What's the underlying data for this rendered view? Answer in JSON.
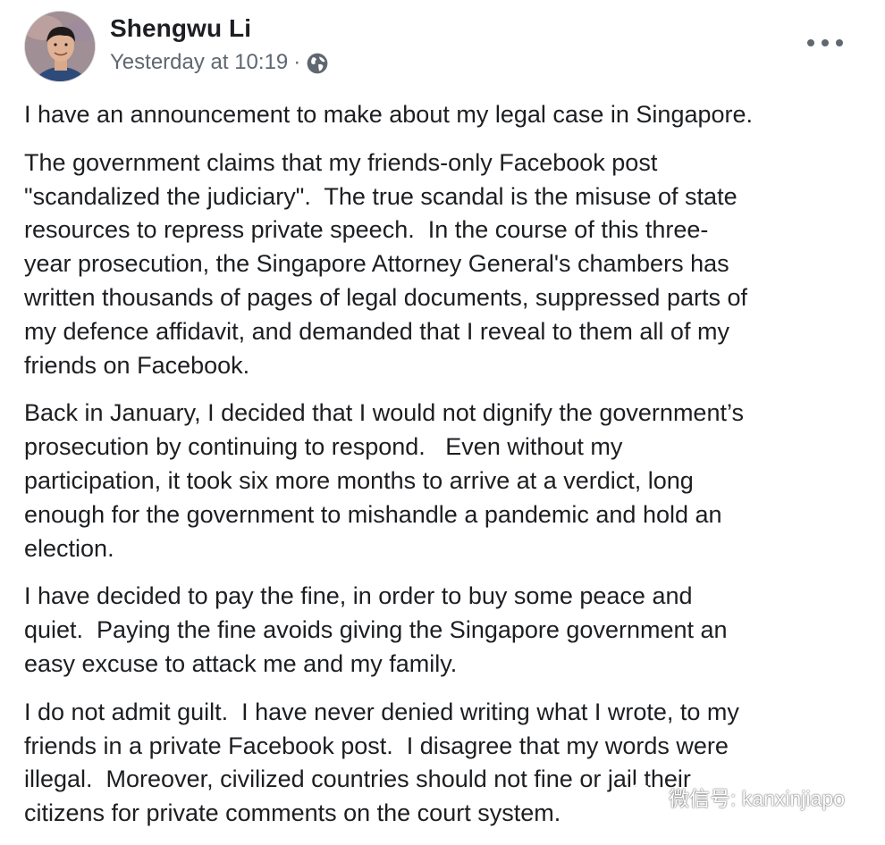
{
  "post": {
    "author": "Shengwu Li",
    "timestamp": "Yesterday at 10:19",
    "separator": "·",
    "privacy_icon": "globe-icon",
    "menu_icon": "more-options-icon"
  },
  "paragraphs": [
    "I have an announcement to make about my legal case in Singapore.",
    "The government claims that my friends-only Facebook post\n\"scandalized the judiciary\".  The true scandal is the misuse of state\nresources to repress private speech.  In the course of this three-\nyear prosecution, the Singapore Attorney General's chambers has\nwritten thousands of pages of legal documents, suppressed parts of\nmy defence affidavit, and demanded that I reveal to them all of my\nfriends on Facebook.",
    "Back in January, I decided that I would not dignify the government’s\nprosecution by continuing to respond.   Even without my\nparticipation, it took six more months to arrive at a verdict, long\nenough for the government to mishandle a pandemic and hold an\nelection.",
    "I have decided to pay the fine, in order to buy some peace and\nquiet.  Paying the fine avoids giving the Singapore government an\neasy excuse to attack me and my family.",
    "I do not admit guilt.  I have never denied writing what I wrote, to my\nfriends in a private Facebook post.  I disagree that my words were\nillegal.  Moreover, civilized countries should not fine or jail their\ncitizens for private comments on the court system."
  ],
  "watermark": {
    "text": "微信号: kanxinjiapo",
    "icon": "wechat-icon"
  }
}
